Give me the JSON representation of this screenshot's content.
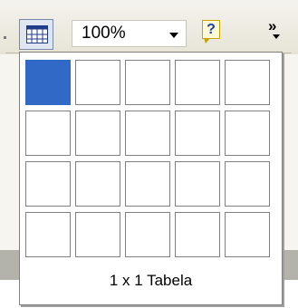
{
  "toolbar": {
    "table_button_icon": "table-grid-icon",
    "zoom": {
      "value": "100%",
      "icon": "chevron-down-icon"
    },
    "help_button": {
      "glyph": "?",
      "icon": "help-icon"
    },
    "overflow_button": {
      "glyph": "»",
      "icon": "toolbar-overflow-icon"
    }
  },
  "table_picker": {
    "rows": 4,
    "columns": 5,
    "selected_rows": 1,
    "selected_columns": 1,
    "selection_color": "#3169c6",
    "label": "1 x 1 Tabela"
  }
}
